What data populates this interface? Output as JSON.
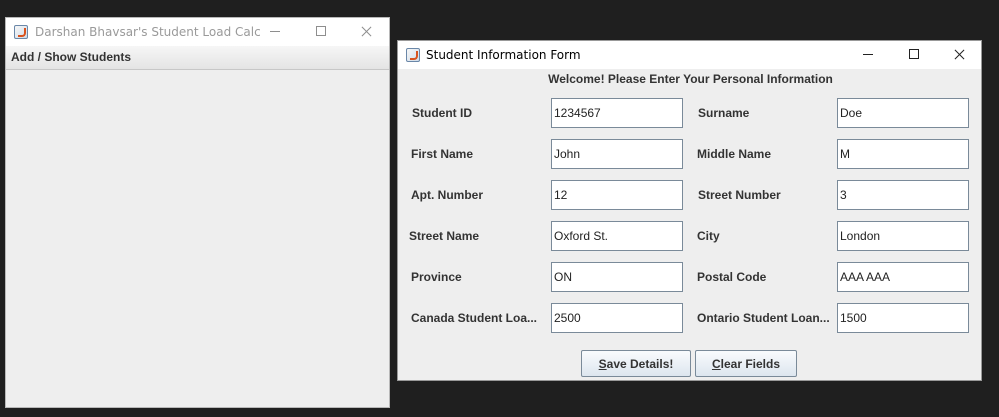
{
  "back_window": {
    "title": "Darshan Bhavsar's Student Load Calcul...",
    "menu": [
      "Add / Show Students"
    ]
  },
  "form_window": {
    "title": "Student Information Form",
    "welcome": "Welcome! Please Enter Your Personal Information",
    "fields": {
      "student_id": {
        "label": "Student ID",
        "value": "1234567"
      },
      "surname": {
        "label": "Surname",
        "value": "Doe"
      },
      "first_name": {
        "label": "First Name",
        "value": "John"
      },
      "middle_name": {
        "label": "Middle Name",
        "value": "M"
      },
      "apt_number": {
        "label": "Apt. Number",
        "value": "12"
      },
      "street_number": {
        "label": "Street Number",
        "value": "3"
      },
      "street_name": {
        "label": "Street Name",
        "value": "Oxford St."
      },
      "city": {
        "label": "City",
        "value": "London"
      },
      "province": {
        "label": "Province",
        "value": "ON"
      },
      "postal_code": {
        "label": "Postal Code",
        "value": "AAA AAA"
      },
      "canada_loan": {
        "label": "Canada Student Loa...",
        "value": "2500"
      },
      "ontario_loan": {
        "label": "Ontario Student Loan...",
        "value": "1500"
      }
    },
    "buttons": {
      "save": {
        "mnemonic": "S",
        "rest": "ave Details!"
      },
      "clear": {
        "mnemonic": "C",
        "rest": "lear Fields"
      }
    }
  },
  "icons": {
    "app": "java-coffee-cup-icon",
    "minimize": "minimize-icon",
    "maximize": "maximize-icon",
    "close": "close-icon"
  },
  "colors": {
    "desktop": "#1f1f1f",
    "window_background": "#eeeeee",
    "titlebar": "#ffffff",
    "inactive_title_text": "#9a9a9a",
    "field_border": "#7a8a99"
  }
}
